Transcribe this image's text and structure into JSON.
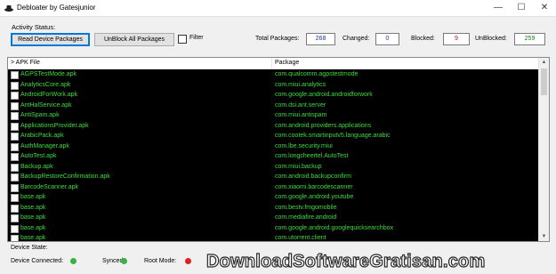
{
  "window": {
    "title": "Debloater by Gatesjunior",
    "minimize": "—",
    "maximize": "☐",
    "close": "✕"
  },
  "activity": {
    "label": "Activity Status:",
    "read_button": "Read Device Packages",
    "unblock_button": "UnBlock All Packages",
    "filter_label": "Filter",
    "filter_checked": false
  },
  "counts": {
    "total_label": "Total Packages:",
    "total_value": "268",
    "changed_label": "Changed:",
    "changed_value": "0",
    "blocked_label": "Blocked:",
    "blocked_value": "9",
    "unblocked_label": "UnBlocked:",
    "unblocked_value": "259"
  },
  "list": {
    "col_apk": "> APK File",
    "col_package": "Package",
    "rows": [
      {
        "apk": "AGPSTestMode.apk",
        "package": "com.qualcomm.agpstestmode"
      },
      {
        "apk": "AnalyticsCore.apk",
        "package": "com.miui.analytics"
      },
      {
        "apk": "AndroidForWork.apk",
        "package": "com.google.android.androidforwork"
      },
      {
        "apk": "AntHalService.apk",
        "package": "com.dsi.ant.server"
      },
      {
        "apk": "AntiSpam.apk",
        "package": "com.miui.antispam"
      },
      {
        "apk": "ApplicationsProvider.apk",
        "package": "com.android.providers.applications"
      },
      {
        "apk": "ArabicPack.apk",
        "package": "com.cootek.smartinputv5.language.arabic"
      },
      {
        "apk": "AuthManager.apk",
        "package": "com.lbe.security.miui"
      },
      {
        "apk": "AutoTest.apk",
        "package": "com.longcheertel.AutoTest"
      },
      {
        "apk": "Backup.apk",
        "package": "com.miui.backup"
      },
      {
        "apk": "BackupRestoreConfirmation.apk",
        "package": "com.android.backupconfirm"
      },
      {
        "apk": "BarcodeScanner.apk",
        "package": "com.xiaomi.barcodescanner"
      },
      {
        "apk": "base.apk",
        "package": "com.google.android.youtube"
      },
      {
        "apk": "base.apk",
        "package": "com.bestv.fmgomobile"
      },
      {
        "apk": "base.apk",
        "package": "com.mediafire.android"
      },
      {
        "apk": "base.apk",
        "package": "com.google.android.googlequicksearchbox"
      },
      {
        "apk": "base.apk",
        "package": "com.utorrent.client"
      }
    ]
  },
  "device": {
    "state_label": "Device State:",
    "connected_label": "Device Connected:",
    "synced_label": "Synced:",
    "root_label": "Root Mode:",
    "connected_color": "#3cb043",
    "synced_color": "#3cb043",
    "root_color": "#e02020"
  },
  "watermark": "DownloadSoftwareGratisan.com"
}
